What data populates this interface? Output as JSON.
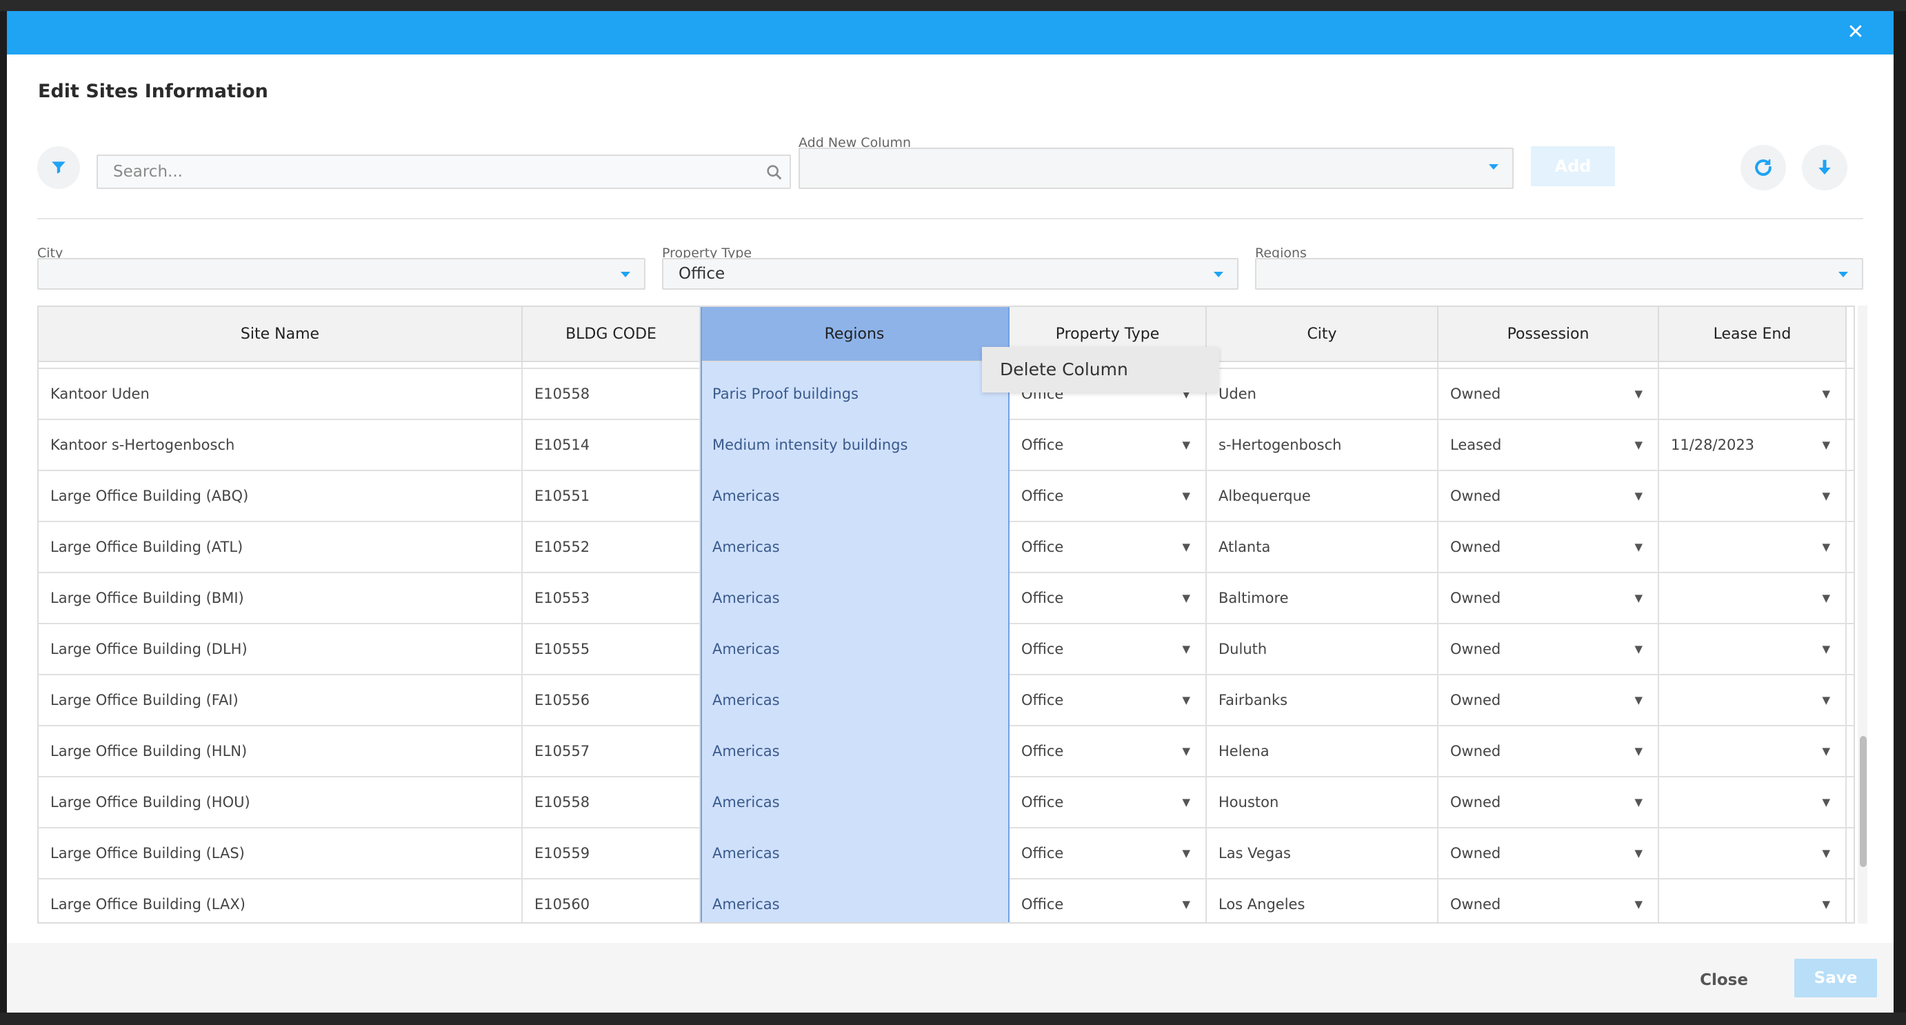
{
  "modal": {
    "title": "Edit Sites Information",
    "close_icon": "close-icon"
  },
  "toolbar": {
    "search_placeholder": "Search...",
    "add_column_label": "Add New Column",
    "add_column_value": "",
    "add_button": "Add"
  },
  "filters": {
    "city": {
      "label": "City",
      "value": ""
    },
    "property_type": {
      "label": "Property Type",
      "value": "Office"
    },
    "regions": {
      "label": "Regions",
      "value": ""
    }
  },
  "table": {
    "columns": [
      "Site Name",
      "BLDG CODE",
      "Regions",
      "Property Type",
      "City",
      "Possession",
      "Lease End"
    ],
    "selected_column": "Regions",
    "rows": [
      {
        "site": "Kantoor Uden",
        "code": "E10558",
        "region": "Paris Proof buildings",
        "ptype": "Office",
        "city": "Uden",
        "possession": "Owned",
        "lease_end": ""
      },
      {
        "site": "Kantoor s-Hertogenbosch",
        "code": "E10514",
        "region": "Medium intensity buildings",
        "ptype": "Office",
        "city": "s-Hertogenbosch",
        "possession": "Leased",
        "lease_end": "11/28/2023"
      },
      {
        "site": "Large Office Building (ABQ)",
        "code": "E10551",
        "region": "Americas",
        "ptype": "Office",
        "city": "Albequerque",
        "possession": "Owned",
        "lease_end": ""
      },
      {
        "site": "Large Office Building (ATL)",
        "code": "E10552",
        "region": "Americas",
        "ptype": "Office",
        "city": "Atlanta",
        "possession": "Owned",
        "lease_end": ""
      },
      {
        "site": "Large Office Building (BMI)",
        "code": "E10553",
        "region": "Americas",
        "ptype": "Office",
        "city": "Baltimore",
        "possession": "Owned",
        "lease_end": ""
      },
      {
        "site": "Large Office Building (DLH)",
        "code": "E10555",
        "region": "Americas",
        "ptype": "Office",
        "city": "Duluth",
        "possession": "Owned",
        "lease_end": ""
      },
      {
        "site": "Large Office Building (FAI)",
        "code": "E10556",
        "region": "Americas",
        "ptype": "Office",
        "city": "Fairbanks",
        "possession": "Owned",
        "lease_end": ""
      },
      {
        "site": "Large Office Building (HLN)",
        "code": "E10557",
        "region": "Americas",
        "ptype": "Office",
        "city": "Helena",
        "possession": "Owned",
        "lease_end": ""
      },
      {
        "site": "Large Office Building (HOU)",
        "code": "E10558",
        "region": "Americas",
        "ptype": "Office",
        "city": "Houston",
        "possession": "Owned",
        "lease_end": ""
      },
      {
        "site": "Large Office Building (LAS)",
        "code": "E10559",
        "region": "Americas",
        "ptype": "Office",
        "city": "Las Vegas",
        "possession": "Owned",
        "lease_end": ""
      },
      {
        "site": "Large Office Building (LAX)",
        "code": "E10560",
        "region": "Americas",
        "ptype": "Office",
        "city": "Los Angeles",
        "possession": "Owned",
        "lease_end": ""
      }
    ]
  },
  "context_menu": {
    "items": [
      "Delete Column"
    ]
  },
  "footer": {
    "close_label": "Close",
    "save_label": "Save"
  },
  "colors": {
    "header": "#1fa3f3",
    "accent": "#1fa3f3",
    "selected_header": "#8eb3e9",
    "selected_cell": "#cfe0fb"
  },
  "icons": {
    "filter": "filter-icon",
    "search": "search-icon",
    "refresh": "refresh-icon",
    "download": "download-icon",
    "dropdown": "chevron-down-icon"
  }
}
